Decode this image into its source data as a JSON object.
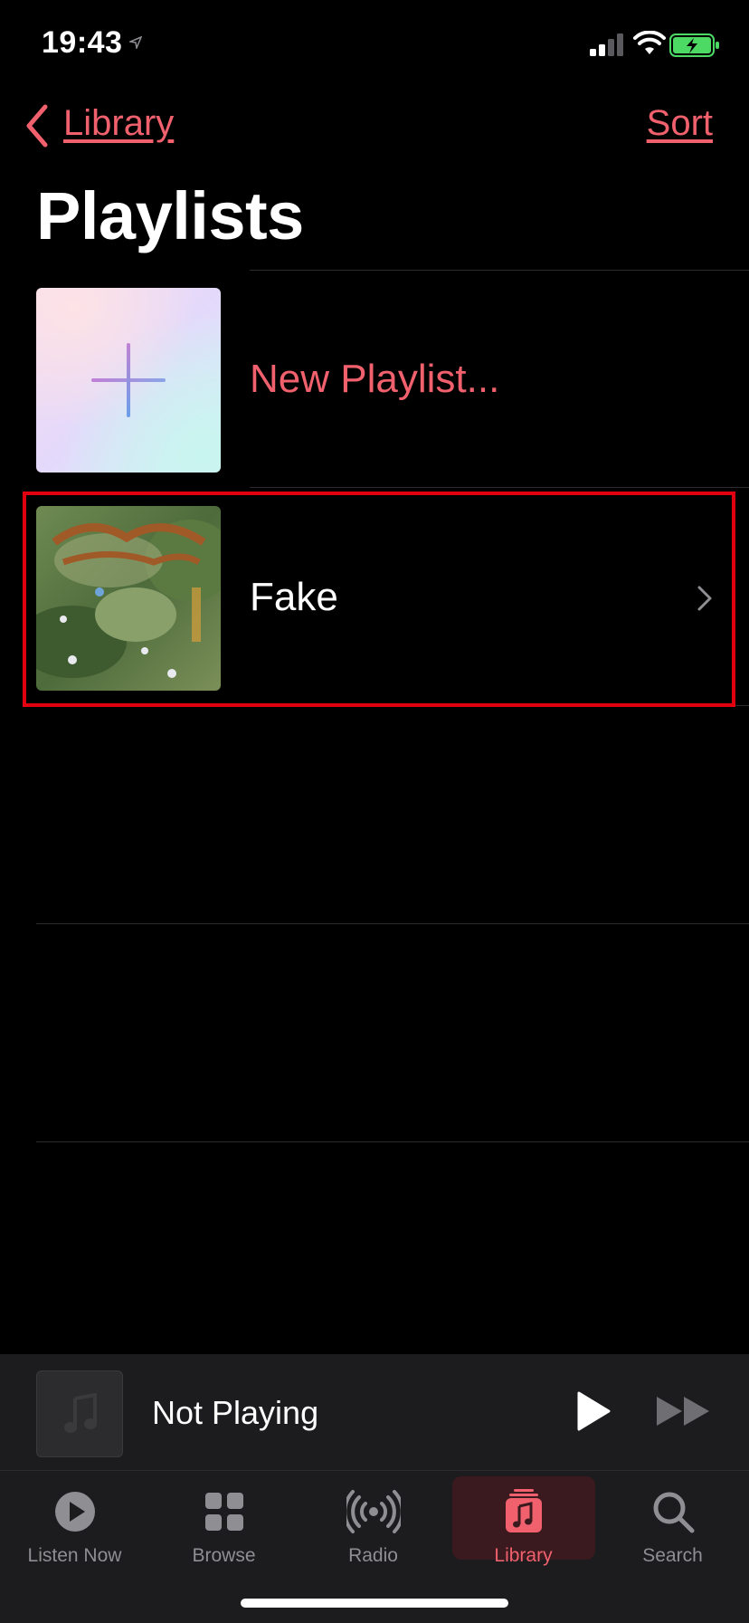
{
  "status_bar": {
    "time": "19:43"
  },
  "nav": {
    "back_label": "Library",
    "sort_label": "Sort"
  },
  "page": {
    "title": "Playlists"
  },
  "playlists": [
    {
      "label": "New Playlist..."
    },
    {
      "label": "Fake"
    }
  ],
  "mini_player": {
    "title": "Not Playing"
  },
  "tabs": [
    {
      "label": "Listen Now",
      "icon": "play-circle-icon"
    },
    {
      "label": "Browse",
      "icon": "grid-icon"
    },
    {
      "label": "Radio",
      "icon": "broadcast-icon"
    },
    {
      "label": "Library",
      "icon": "music-note-icon"
    },
    {
      "label": "Search",
      "icon": "search-icon"
    }
  ],
  "colors": {
    "accent": "#f0616d",
    "highlight_box": "#e10010",
    "background": "#000000"
  }
}
